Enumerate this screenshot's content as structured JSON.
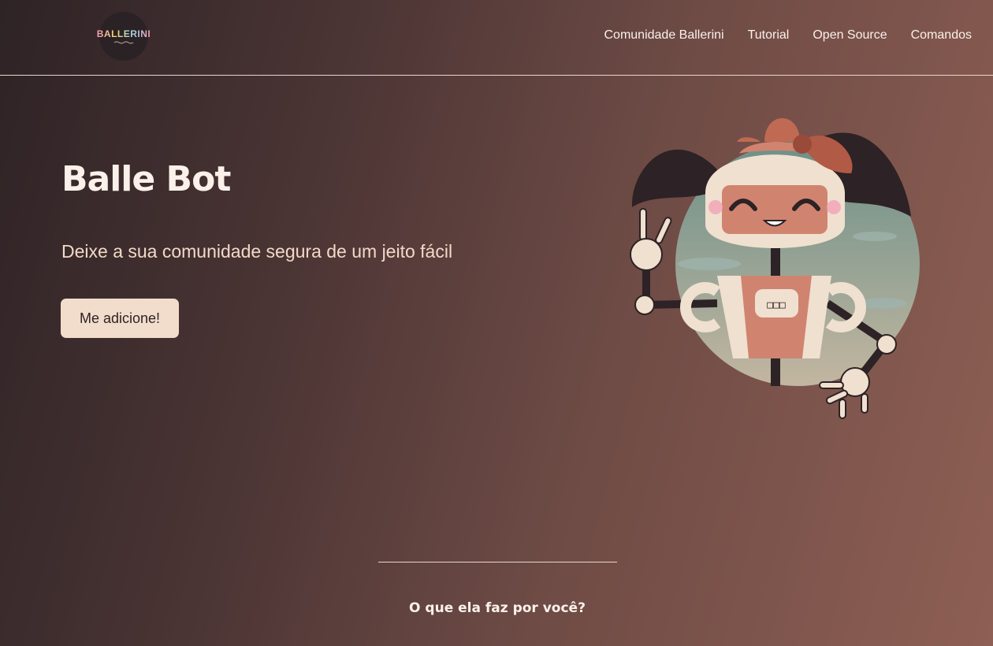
{
  "header": {
    "logo_text": "BALLERINI",
    "nav": [
      {
        "label": "Comunidade Ballerini"
      },
      {
        "label": "Tutorial"
      },
      {
        "label": "Open Source"
      },
      {
        "label": "Comandos"
      }
    ]
  },
  "hero": {
    "title": "Balle Bot",
    "subtitle": "Deixe a sua comunidade segura de um jeito fácil",
    "cta_label": "Me adicione!",
    "robot_panel_text": "□□□"
  },
  "section": {
    "title": "O que ela faz por você?"
  },
  "colors": {
    "accent": "#f2dccb",
    "text": "#fbf1ea",
    "bg_dark": "#2e2325",
    "bg_light": "#8e5f54"
  }
}
